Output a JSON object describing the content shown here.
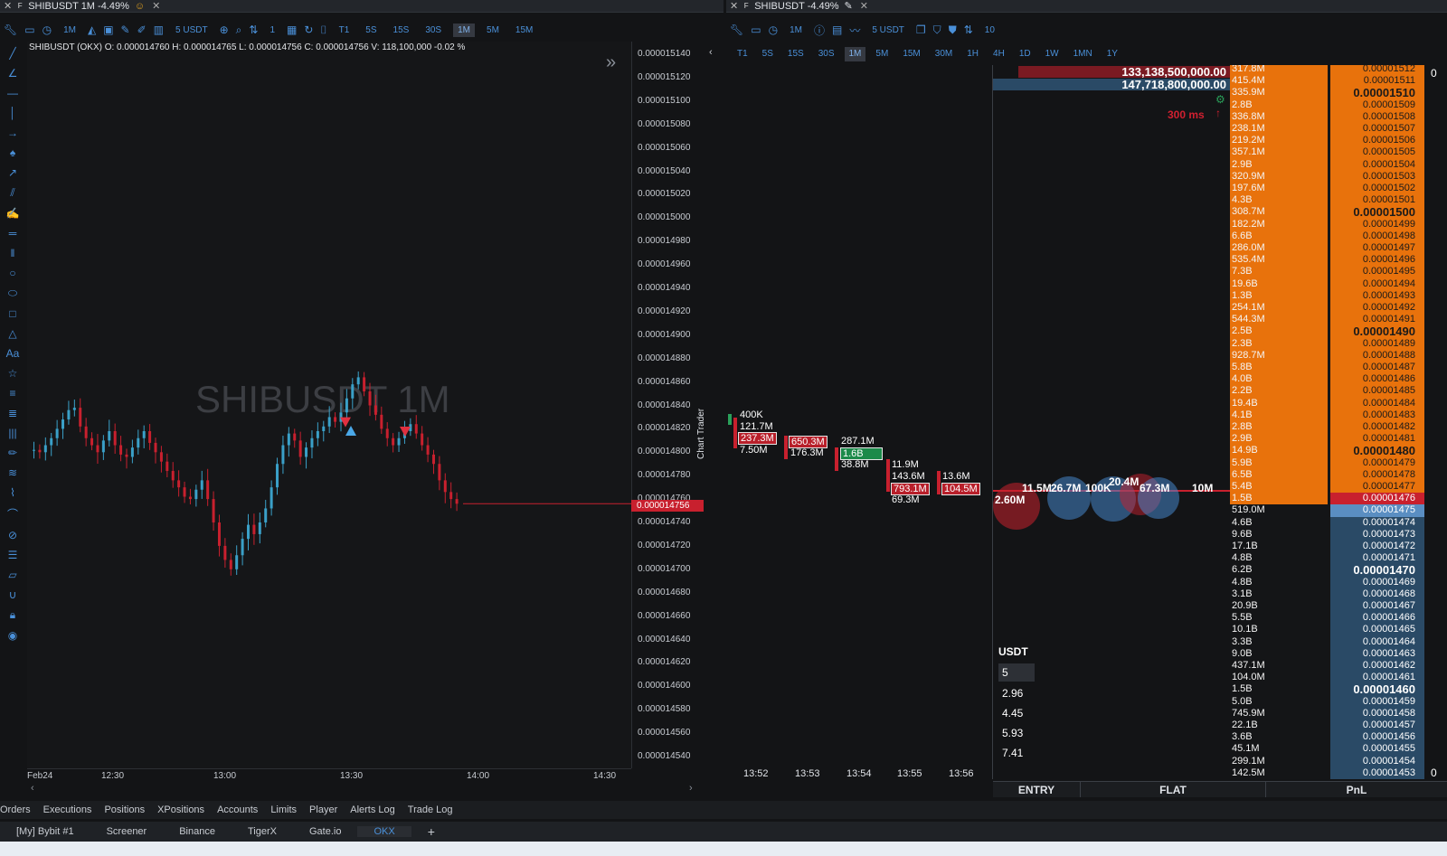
{
  "left_window": {
    "title": "SHIBUSDT 1M -4.49%",
    "toolbar": {
      "timeframe": "1M",
      "size": "5 USDT",
      "qty": "1",
      "timeframes": [
        "T1",
        "5S",
        "15S",
        "30S",
        "1M",
        "5M",
        "15M"
      ],
      "active_tf": "1M"
    },
    "ohlc": "SHIBUSDT (OKX)  O: 0.000014760 H: 0.000014765 L: 0.000014756 C: 0.000014756 V: 118,100,000 -0.02 %",
    "watermark": "SHIBUSDT 1M",
    "last_price": "0.000014756",
    "y_ticks": [
      "0.000015140",
      "0.000015120",
      "0.000015100",
      "0.000015080",
      "0.000015060",
      "0.000015040",
      "0.000015020",
      "0.000015000",
      "0.000014980",
      "0.000014960",
      "0.000014940",
      "0.000014920",
      "0.000014900",
      "0.000014880",
      "0.000014860",
      "0.000014840",
      "0.000014820",
      "0.000014800",
      "0.000014780",
      "0.000014760",
      "0.000014740",
      "0.000014720",
      "0.000014700",
      "0.000014680",
      "0.000014660",
      "0.000014640",
      "0.000014620",
      "0.000014600",
      "0.000014580",
      "0.000014560",
      "0.000014540"
    ],
    "x_ticks": [
      "Feb24",
      "12:30",
      "13:00",
      "13:30",
      "14:00",
      "14:30"
    ]
  },
  "right_window": {
    "title": "SHIBUSDT -4.49%",
    "toolbar": {
      "timeframe": "1M",
      "size": "5 USDT",
      "qty": "10"
    },
    "timeframes": [
      "T1",
      "5S",
      "15S",
      "30S",
      "1M",
      "5M",
      "15M",
      "30M",
      "1H",
      "4H",
      "1D",
      "1W",
      "1MN",
      "1Y"
    ],
    "active_tf": "1M",
    "side_label": "Chart Trader",
    "big_orders": [
      "133,138,500,000.00",
      "147,718,800,000.00"
    ],
    "latency": "300 ms",
    "x_ticks": [
      "13:52",
      "13:53",
      "13:54",
      "13:55",
      "13:56"
    ],
    "usdt_label": "USDT",
    "usdt_values": [
      "5",
      "2.96",
      "4.45",
      "5.93",
      "7.41"
    ],
    "bottom_labels": [
      "ENTRY",
      "FLAT",
      "PnL"
    ],
    "edge_top": "0",
    "edge_bottom": "0",
    "cluster_labels": [
      "400K",
      "121.7M",
      "237.3M",
      "7.50M",
      "650.3M",
      "176.3M",
      "287.1M",
      "1.6B",
      "38.8M",
      "11.9M",
      "143.6M",
      "793.1M",
      "69.3M",
      "13.6M",
      "104.5M",
      "2.60M",
      "11.5M",
      "26.7M",
      "100K",
      "20.4M",
      "67.3M",
      "10M"
    ],
    "orderbook": [
      {
        "v": "317.8M",
        "p": "0.00001512",
        "t": "ask"
      },
      {
        "v": "415.4M",
        "p": "0.00001511",
        "t": "ask"
      },
      {
        "v": "335.9M",
        "p": "0.00001510",
        "t": "ask",
        "b": true
      },
      {
        "v": "2.8B",
        "p": "0.00001509",
        "t": "ask"
      },
      {
        "v": "336.8M",
        "p": "0.00001508",
        "t": "ask"
      },
      {
        "v": "238.1M",
        "p": "0.00001507",
        "t": "ask"
      },
      {
        "v": "219.2M",
        "p": "0.00001506",
        "t": "ask"
      },
      {
        "v": "357.1M",
        "p": "0.00001505",
        "t": "ask"
      },
      {
        "v": "2.9B",
        "p": "0.00001504",
        "t": "ask"
      },
      {
        "v": "320.9M",
        "p": "0.00001503",
        "t": "ask"
      },
      {
        "v": "197.6M",
        "p": "0.00001502",
        "t": "ask"
      },
      {
        "v": "4.3B",
        "p": "0.00001501",
        "t": "ask"
      },
      {
        "v": "308.7M",
        "p": "0.00001500",
        "t": "ask",
        "b": true
      },
      {
        "v": "182.2M",
        "p": "0.00001499",
        "t": "ask"
      },
      {
        "v": "6.6B",
        "p": "0.00001498",
        "t": "ask"
      },
      {
        "v": "286.0M",
        "p": "0.00001497",
        "t": "ask"
      },
      {
        "v": "535.4M",
        "p": "0.00001496",
        "t": "ask"
      },
      {
        "v": "7.3B",
        "p": "0.00001495",
        "t": "ask"
      },
      {
        "v": "19.6B",
        "p": "0.00001494",
        "t": "ask"
      },
      {
        "v": "1.3B",
        "p": "0.00001493",
        "t": "ask"
      },
      {
        "v": "254.1M",
        "p": "0.00001492",
        "t": "ask"
      },
      {
        "v": "544.3M",
        "p": "0.00001491",
        "t": "ask"
      },
      {
        "v": "2.5B",
        "p": "0.00001490",
        "t": "ask",
        "b": true
      },
      {
        "v": "2.3B",
        "p": "0.00001489",
        "t": "ask"
      },
      {
        "v": "928.7M",
        "p": "0.00001488",
        "t": "ask"
      },
      {
        "v": "5.8B",
        "p": "0.00001487",
        "t": "ask"
      },
      {
        "v": "4.0B",
        "p": "0.00001486",
        "t": "ask"
      },
      {
        "v": "2.2B",
        "p": "0.00001485",
        "t": "ask"
      },
      {
        "v": "19.4B",
        "p": "0.00001484",
        "t": "ask"
      },
      {
        "v": "4.1B",
        "p": "0.00001483",
        "t": "ask"
      },
      {
        "v": "2.8B",
        "p": "0.00001482",
        "t": "ask"
      },
      {
        "v": "2.9B",
        "p": "0.00001481",
        "t": "ask"
      },
      {
        "v": "14.9B",
        "p": "0.00001480",
        "t": "ask",
        "b": true
      },
      {
        "v": "5.9B",
        "p": "0.00001479",
        "t": "ask"
      },
      {
        "v": "6.5B",
        "p": "0.00001478",
        "t": "ask"
      },
      {
        "v": "5.4B",
        "p": "0.00001477",
        "t": "ask"
      },
      {
        "v": "1.5B",
        "p": "0.00001476",
        "t": "last"
      },
      {
        "v": "519.0M",
        "p": "0.00001475",
        "t": "bestbid"
      },
      {
        "v": "4.6B",
        "p": "0.00001474",
        "t": "bid"
      },
      {
        "v": "9.6B",
        "p": "0.00001473",
        "t": "bid"
      },
      {
        "v": "17.1B",
        "p": "0.00001472",
        "t": "bid"
      },
      {
        "v": "4.8B",
        "p": "0.00001471",
        "t": "bid"
      },
      {
        "v": "6.2B",
        "p": "0.00001470",
        "t": "bid",
        "b": true
      },
      {
        "v": "4.8B",
        "p": "0.00001469",
        "t": "bid"
      },
      {
        "v": "3.1B",
        "p": "0.00001468",
        "t": "bid"
      },
      {
        "v": "20.9B",
        "p": "0.00001467",
        "t": "bid"
      },
      {
        "v": "5.5B",
        "p": "0.00001466",
        "t": "bid"
      },
      {
        "v": "10.1B",
        "p": "0.00001465",
        "t": "bid"
      },
      {
        "v": "3.3B",
        "p": "0.00001464",
        "t": "bid"
      },
      {
        "v": "9.0B",
        "p": "0.00001463",
        "t": "bid"
      },
      {
        "v": "437.1M",
        "p": "0.00001462",
        "t": "bid"
      },
      {
        "v": "104.0M",
        "p": "0.00001461",
        "t": "bid"
      },
      {
        "v": "1.5B",
        "p": "0.00001460",
        "t": "bid",
        "b": true
      },
      {
        "v": "5.0B",
        "p": "0.00001459",
        "t": "bid"
      },
      {
        "v": "745.9M",
        "p": "0.00001458",
        "t": "bid"
      },
      {
        "v": "22.1B",
        "p": "0.00001457",
        "t": "bid"
      },
      {
        "v": "3.6B",
        "p": "0.00001456",
        "t": "bid"
      },
      {
        "v": "45.1M",
        "p": "0.00001455",
        "t": "bid"
      },
      {
        "v": "299.1M",
        "p": "0.00001454",
        "t": "bid"
      },
      {
        "v": "142.5M",
        "p": "0.00001453",
        "t": "bid"
      }
    ]
  },
  "bottom_tabs": [
    "Orders",
    "Executions",
    "Positions",
    "XPositions",
    "Accounts",
    "Limits",
    "Player",
    "Alerts Log",
    "Trade Log"
  ],
  "workspaces": [
    "[My] Bybit #1",
    "Screener",
    "Binance",
    "TigerX",
    "Gate.io",
    "OKX"
  ],
  "active_workspace": "OKX",
  "colors": {
    "up": "#3aa0c8",
    "down": "#c8202e",
    "orange": "#e8720c",
    "bid": "#2a4a66",
    "ask_bg": "#e8720c",
    "last": "#c8202e"
  }
}
